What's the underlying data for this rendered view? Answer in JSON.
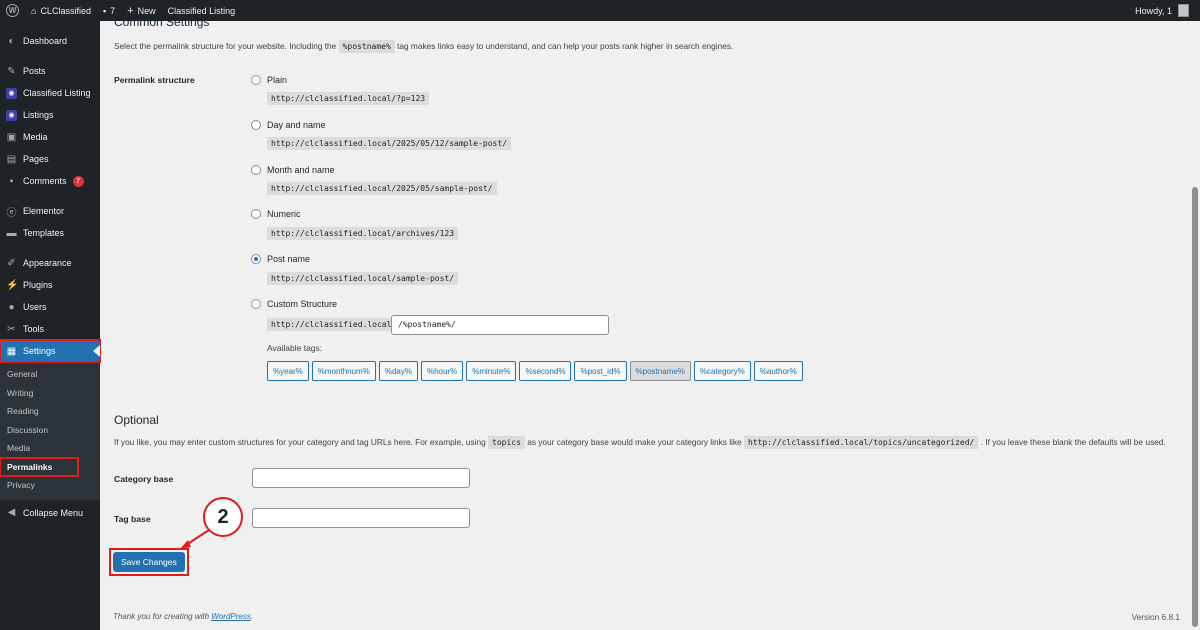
{
  "adminbar": {
    "site_name": "CLClassified",
    "comments_count": "7",
    "new_label": "New",
    "classified_label": "Classified Listing",
    "howdy": "Howdy, 1"
  },
  "sidebar": {
    "items": [
      {
        "label": "Dashboard",
        "icon": "dashboard-icon"
      },
      {
        "label": "Posts",
        "icon": "pin-icon"
      },
      {
        "label": "Classified Listing",
        "icon": "classified-icon"
      },
      {
        "label": "Listings",
        "icon": "classified-icon"
      },
      {
        "label": "Media",
        "icon": "media-icon"
      },
      {
        "label": "Pages",
        "icon": "page-icon"
      },
      {
        "label": "Comments",
        "icon": "comment-icon",
        "badge": "7"
      },
      {
        "label": "Elementor",
        "icon": "elementor-icon"
      },
      {
        "label": "Templates",
        "icon": "folder-icon"
      },
      {
        "label": "Appearance",
        "icon": "brush-icon"
      },
      {
        "label": "Plugins",
        "icon": "plug-icon"
      },
      {
        "label": "Users",
        "icon": "user-icon"
      },
      {
        "label": "Tools",
        "icon": "wrench-icon"
      },
      {
        "label": "Settings",
        "icon": "settings-icon"
      }
    ],
    "submenu": [
      "General",
      "Writing",
      "Reading",
      "Discussion",
      "Media",
      "Permalinks",
      "Privacy"
    ],
    "collapse": "Collapse Menu"
  },
  "common": {
    "heading": "Common Settings",
    "desc_before": "Select the permalink structure for your website. Including the",
    "desc_code": "%postname%",
    "desc_after": "tag makes links easy to understand, and can help your posts rank higher in search engines.",
    "structure_label": "Permalink structure",
    "options": [
      {
        "label": "Plain",
        "sample": "http://clclassified.local/?p=123",
        "checked": false
      },
      {
        "label": "Day and name",
        "sample": "http://clclassified.local/2025/05/12/sample-post/",
        "checked": false
      },
      {
        "label": "Month and name",
        "sample": "http://clclassified.local/2025/05/sample-post/",
        "checked": false
      },
      {
        "label": "Numeric",
        "sample": "http://clclassified.local/archives/123",
        "checked": false
      },
      {
        "label": "Post name",
        "sample": "http://clclassified.local/sample-post/",
        "checked": true
      },
      {
        "label": "Custom Structure",
        "checked": false
      }
    ],
    "custom_prefix": "http://clclassified.local",
    "custom_value": "/%postname%/",
    "available_tags_label": "Available tags:",
    "tags": [
      "%year%",
      "%monthnum%",
      "%day%",
      "%hour%",
      "%minute%",
      "%second%",
      "%post_id%",
      "%postname%",
      "%category%",
      "%author%"
    ],
    "active_tag": "%postname%"
  },
  "optional": {
    "heading": "Optional",
    "desc_1": "If you like, you may enter custom structures for your category and tag URLs here. For example, using",
    "desc_code_1": "topics",
    "desc_2": "as your category base would make your category links like",
    "desc_code_2": "http://clclassified.local/topics/uncategorized/",
    "desc_3": ". If you leave these blank the defaults will be used.",
    "category_label": "Category base",
    "category_value": "",
    "tag_label": "Tag base",
    "tag_value": ""
  },
  "save_label": "Save Changes",
  "annotation": "2",
  "footer": {
    "thanks": "Thank you for creating with",
    "link": "WordPress",
    "period": ".",
    "version": "Version 6.8.1"
  },
  "colors": {
    "accent": "#2271b1",
    "highlight": "#e21b1b",
    "sidebar": "#1d2327"
  }
}
